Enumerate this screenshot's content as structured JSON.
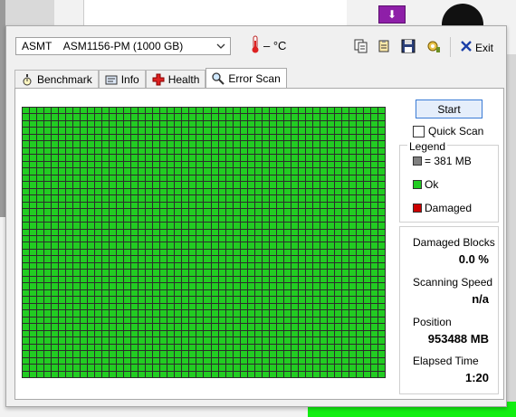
{
  "background": {
    "purple_icon": "⬇"
  },
  "toolbar": {
    "drive": "ASMT    ASM1156-PM (1000 GB)",
    "temperature": "– °C",
    "buttons": [
      "copy-icon",
      "copy-info-icon",
      "save-icon",
      "options-icon"
    ],
    "exit_label": "Exit"
  },
  "tabs": [
    {
      "label": "Benchmark",
      "icon": "stopwatch-icon"
    },
    {
      "label": "Info",
      "icon": "info-icon"
    },
    {
      "label": "Health",
      "icon": "health-icon"
    },
    {
      "label": "Error Scan",
      "icon": "magnifier-icon",
      "active": true
    }
  ],
  "scan": {
    "start_label": "Start",
    "quick_scan_label": "Quick Scan",
    "quick_scan_checked": false,
    "grid_columns": 50,
    "grid_rows": 40,
    "block_status": "ok"
  },
  "legend": {
    "title": "Legend",
    "block_size": "= 381 MB",
    "ok": "Ok",
    "damaged": "Damaged",
    "colors": {
      "block": "#808080",
      "ok": "#22cc22",
      "damaged": "#cc0000"
    }
  },
  "stats": {
    "damaged_blocks_label": "Damaged Blocks",
    "damaged_blocks": "0.0 %",
    "speed_label": "Scanning Speed",
    "speed": "n/a",
    "position_label": "Position",
    "position": "953488 MB",
    "elapsed_label": "Elapsed Time",
    "elapsed": "1:20"
  }
}
